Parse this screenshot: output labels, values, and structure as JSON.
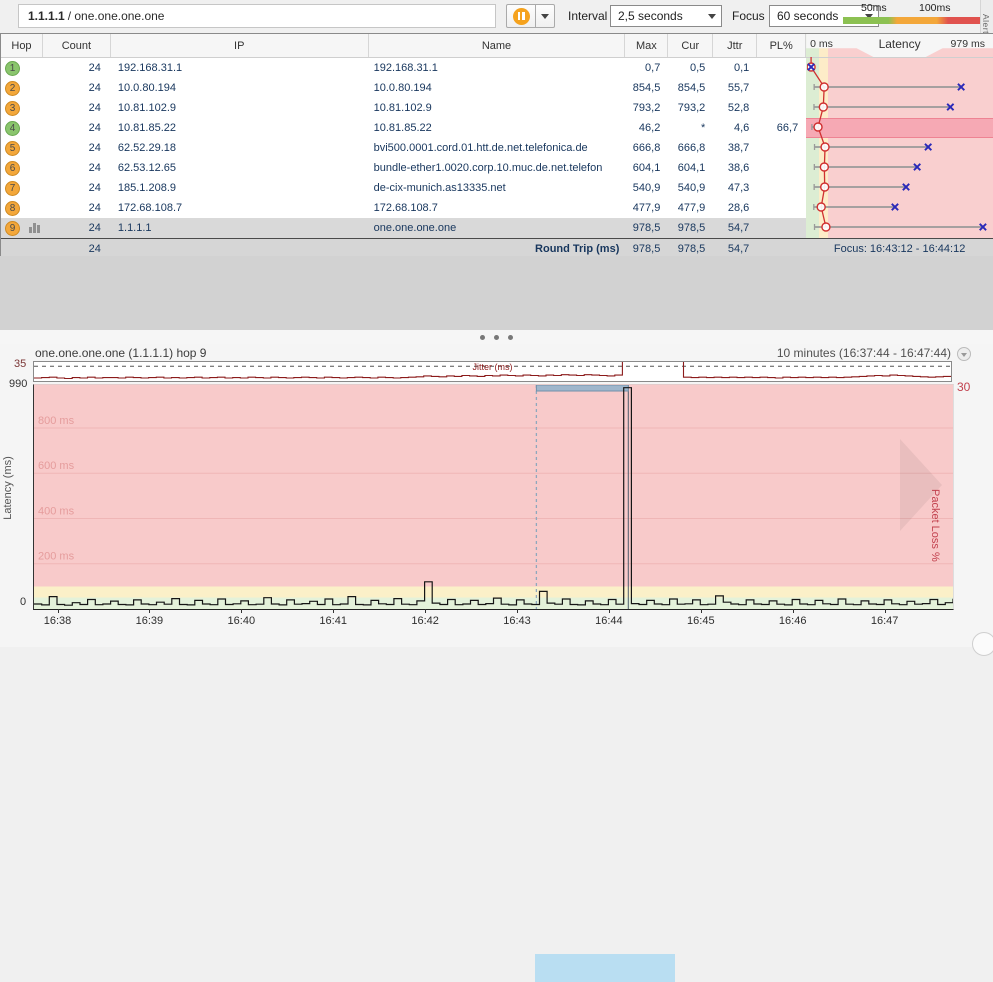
{
  "toolbar": {
    "target_bold": "1.1.1.1",
    "target_rest": " / one.one.one.one",
    "interval_label": "Interval",
    "interval_value": "2,5 seconds",
    "focus_label": "Focus",
    "focus_value": "60 seconds",
    "legend_50": "50ms",
    "legend_100": "100ms",
    "alerts_tab": "Alerts",
    "colors": {
      "green": "#8cc152",
      "orange": "#f3a73a",
      "red": "#e0524e",
      "pause_orange": "#f5a21d"
    }
  },
  "table": {
    "headers": {
      "hop": "Hop",
      "count": "Count",
      "ip": "IP",
      "name": "Name",
      "max": "Max",
      "cur": "Cur",
      "jttr": "Jttr",
      "pl": "PL%",
      "latency_zero": "0 ms",
      "latency_title": "Latency",
      "latency_max": "979 ms"
    },
    "rows": [
      {
        "hop": "1",
        "badge": "green",
        "count": "24",
        "ip": "192.168.31.1",
        "name": "192.168.31.1",
        "max": "0,7",
        "cur": "0,5",
        "jttr": "0,1",
        "pl": "",
        "selected": false,
        "graph_icon": false,
        "loss": false,
        "marker": {
          "min": 0.2,
          "avg": 0.5,
          "cur": 0.7,
          "max": 0.7
        }
      },
      {
        "hop": "2",
        "badge": "orange",
        "count": "24",
        "ip": "10.0.80.194",
        "name": "10.0.80.194",
        "max": "854,5",
        "cur": "854,5",
        "jttr": "55,7",
        "pl": "",
        "selected": false,
        "graph_icon": false,
        "loss": false,
        "marker": {
          "min": 18,
          "avg": 75,
          "cur": 854.5,
          "max": 854.5
        }
      },
      {
        "hop": "3",
        "badge": "orange",
        "count": "24",
        "ip": "10.81.102.9",
        "name": "10.81.102.9",
        "max": "793,2",
        "cur": "793,2",
        "jttr": "52,8",
        "pl": "",
        "selected": false,
        "graph_icon": false,
        "loss": false,
        "marker": {
          "min": 17,
          "avg": 70,
          "cur": 793.2,
          "max": 793.2
        }
      },
      {
        "hop": "4",
        "badge": "green",
        "count": "24",
        "ip": "10.81.85.22",
        "name": "10.81.85.22",
        "max": "46,2",
        "cur": "*",
        "jttr": "4,6",
        "pl": "66,7",
        "selected": false,
        "graph_icon": false,
        "loss": true,
        "marker": {
          "min": 5,
          "avg": 40,
          "cur": null,
          "max": 46.2
        }
      },
      {
        "hop": "5",
        "badge": "orange",
        "count": "24",
        "ip": "62.52.29.18",
        "name": "bvi500.0001.cord.01.htt.de.net.telefonica.de",
        "max": "666,8",
        "cur": "666,8",
        "jttr": "38,7",
        "pl": "",
        "selected": false,
        "graph_icon": false,
        "loss": false,
        "marker": {
          "min": 20,
          "avg": 80,
          "cur": 666.8,
          "max": 666.8
        }
      },
      {
        "hop": "6",
        "badge": "orange",
        "count": "24",
        "ip": "62.53.12.65",
        "name": "bundle-ether1.0020.corp.10.muc.de.net.telefon",
        "max": "604,1",
        "cur": "604,1",
        "jttr": "38,6",
        "pl": "",
        "selected": false,
        "graph_icon": false,
        "loss": false,
        "marker": {
          "min": 19,
          "avg": 76,
          "cur": 604.1,
          "max": 604.1
        }
      },
      {
        "hop": "7",
        "badge": "orange",
        "count": "24",
        "ip": "185.1.208.9",
        "name": "de-cix-munich.as13335.net",
        "max": "540,9",
        "cur": "540,9",
        "jttr": "47,3",
        "pl": "",
        "selected": false,
        "graph_icon": false,
        "loss": false,
        "marker": {
          "min": 18,
          "avg": 78,
          "cur": 540.9,
          "max": 540.9
        }
      },
      {
        "hop": "8",
        "badge": "orange",
        "count": "24",
        "ip": "172.68.108.7",
        "name": "172.68.108.7",
        "max": "477,9",
        "cur": "477,9",
        "jttr": "28,6",
        "pl": "",
        "selected": false,
        "graph_icon": false,
        "loss": false,
        "marker": {
          "min": 16,
          "avg": 58,
          "cur": 477.9,
          "max": 477.9
        }
      },
      {
        "hop": "9",
        "badge": "orange",
        "count": "24",
        "ip": "1.1.1.1",
        "name": "one.one.one.one",
        "max": "978,5",
        "cur": "978,5",
        "jttr": "54,7",
        "pl": "",
        "selected": true,
        "graph_icon": true,
        "loss": false,
        "marker": {
          "min": 20,
          "avg": 85,
          "cur": 978.5,
          "max": 978.5
        }
      }
    ],
    "summary": {
      "count": "24",
      "label": "Round Trip (ms)",
      "max": "978,5",
      "cur": "978,5",
      "jttr": "54,7",
      "focus_text": "Focus: 16:43:12 - 16:44:12"
    },
    "latency_scale_max_ms": 979,
    "marker_colors": {
      "circle": "#d03030",
      "line": "#9a9a9a",
      "x": "#2a2ab8"
    }
  },
  "timeline": {
    "header_left": "one.one.one.one (1.1.1.1) hop 9",
    "header_right": "10 minutes (16:37:44 - 16:47:44)",
    "jitter_axis_label": "35",
    "latency_axis_top": "990",
    "latency_axis_bottom": "0",
    "latency_axis_title": "Latency (ms)",
    "packet_loss_top": "30",
    "packet_loss_title": "Packet Loss %"
  },
  "chart_data": [
    {
      "type": "line",
      "title": "Jitter (ms)",
      "ylim": [
        0,
        45
      ],
      "reference_line": 35,
      "line_color": "#8b1a1a",
      "interval_seconds": 5,
      "x_start": "16:37:44",
      "x_end": "16:47:44",
      "values": [
        7,
        8,
        9,
        7,
        6,
        8,
        7,
        9,
        7,
        8,
        8,
        7,
        9,
        8,
        7,
        8,
        9,
        7,
        8,
        7,
        8,
        9,
        7,
        8,
        9,
        7,
        8,
        7,
        9,
        8,
        7,
        9,
        8,
        7,
        8,
        9,
        8,
        7,
        9,
        8,
        7,
        8,
        9,
        8,
        7,
        9,
        8,
        7,
        8,
        9,
        10,
        12,
        11,
        10,
        12,
        11,
        13,
        12,
        11,
        13,
        12,
        14,
        13,
        12,
        14,
        13,
        12,
        14,
        13,
        15,
        14,
        13,
        15,
        14,
        13,
        12,
        14,
        50,
        50,
        50,
        50,
        50,
        50,
        50,
        50,
        9,
        8,
        9,
        8,
        9,
        8,
        9,
        8,
        9,
        8,
        9,
        8,
        7,
        9,
        8,
        9,
        8,
        9,
        8,
        9,
        8,
        9,
        10,
        11,
        12,
        13,
        12,
        14,
        13,
        12,
        11,
        10,
        9,
        10,
        11,
        12
      ]
    },
    {
      "type": "line",
      "title": "Latency (ms) - hop 9",
      "ylim": [
        0,
        990
      ],
      "gridlines": [
        {
          "v": 800,
          "label": "800 ms"
        },
        {
          "v": 600,
          "label": "600 ms"
        },
        {
          "v": 400,
          "label": "400 ms"
        },
        {
          "v": 200,
          "label": "200 ms"
        }
      ],
      "bands": [
        {
          "from": 0,
          "to": 50,
          "color": "#e4f2da"
        },
        {
          "from": 50,
          "to": 100,
          "color": "#fbf0c8"
        },
        {
          "from": 100,
          "to": 990,
          "color": "#f8caca"
        }
      ],
      "line_color": "#151515",
      "interval_seconds": 5,
      "span_seconds": 600,
      "x_start": "16:37:44",
      "x_end": "16:47:44",
      "x_ticks": [
        {
          "label": "16:38",
          "t": 16
        },
        {
          "label": "16:39",
          "t": 76
        },
        {
          "label": "16:40",
          "t": 136
        },
        {
          "label": "16:41",
          "t": 196
        },
        {
          "label": "16:42",
          "t": 256
        },
        {
          "label": "16:43",
          "t": 316
        },
        {
          "label": "16:44",
          "t": 376
        },
        {
          "label": "16:45",
          "t": 436
        },
        {
          "label": "16:46",
          "t": 496
        },
        {
          "label": "16:47",
          "t": 556
        }
      ],
      "focus": {
        "start": "16:43:12",
        "end": "16:44:12",
        "start_s": 328,
        "end_s": 388,
        "bar_color": "#9fb6cc",
        "axis_highlight_color": "#b9def2"
      },
      "values": [
        22,
        18,
        55,
        20,
        17,
        28,
        20,
        42,
        19,
        22,
        35,
        20,
        18,
        40,
        22,
        19,
        30,
        21,
        46,
        20,
        18,
        38,
        22,
        19,
        44,
        20,
        23,
        36,
        19,
        21,
        50,
        22,
        18,
        40,
        21,
        24,
        34,
        20,
        44,
        19,
        22,
        55,
        20,
        18,
        38,
        23,
        20,
        46,
        21,
        19,
        36,
        120,
        26,
        20,
        42,
        19,
        22,
        38,
        20,
        24,
        48,
        21,
        18,
        40,
        22,
        20,
        78,
        26,
        21,
        44,
        20,
        18,
        36,
        22,
        19,
        42,
        21,
        978,
        24,
        20,
        38,
        22,
        19,
        44,
        21,
        23,
        40,
        19,
        21,
        58,
        30,
        22,
        19,
        40,
        22,
        20,
        36,
        21,
        18,
        42,
        22,
        19,
        38,
        23,
        20,
        44,
        21,
        19,
        36,
        22,
        20,
        40,
        23,
        19,
        34,
        21,
        24,
        42,
        20,
        28,
        45
      ]
    }
  ]
}
